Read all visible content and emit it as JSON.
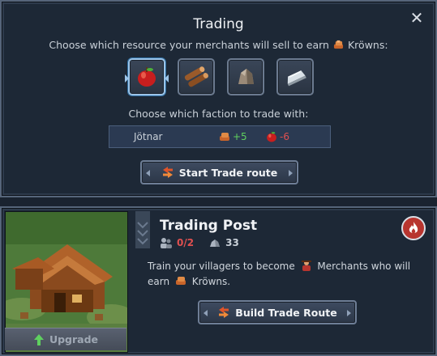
{
  "trading": {
    "title": "Trading",
    "close_icon": "close-icon",
    "resource_prompt_prefix": "Choose which resource your merchants will sell to earn",
    "resource_prompt_currency": "Kröwns:",
    "resources": [
      {
        "name": "food",
        "icon": "apple-icon",
        "selected": true
      },
      {
        "name": "wood",
        "icon": "logs-icon",
        "selected": false
      },
      {
        "name": "stone",
        "icon": "rock-icon",
        "selected": false
      },
      {
        "name": "iron",
        "icon": "iron-ingot-icon",
        "selected": false
      }
    ],
    "faction_prompt": "Choose which faction to trade with:",
    "faction": {
      "name": "Jötnar",
      "krowns_delta": "+5",
      "food_delta": "-6"
    },
    "start_button_label": "Start Trade route"
  },
  "building": {
    "title": "Trading Post",
    "workers": "0/2",
    "cost": "33",
    "desc_part1": "Train your villagers to become",
    "desc_role": "Merchants",
    "desc_part2": "who will earn",
    "desc_currency": "Kröwns.",
    "upgrade_label": "Upgrade",
    "build_button_label": "Build Trade Route",
    "badge_icon": "fire-icon"
  },
  "colors": {
    "positive": "#5fd05f",
    "negative": "#e05050",
    "panel_bg": "#1d2836",
    "accent_selected": "#9cc4e8"
  }
}
